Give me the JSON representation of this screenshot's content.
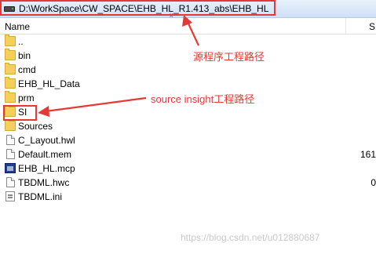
{
  "path_bar": {
    "path": "D:\\WorkSpace\\CW_SPACE\\EHB_HL_R1.413_abs\\EHB_HL",
    "glyph": "x"
  },
  "columns": {
    "name": "Name",
    "size": "S"
  },
  "items": [
    {
      "name": "..",
      "type": "folder",
      "size": ""
    },
    {
      "name": "bin",
      "type": "folder",
      "size": ""
    },
    {
      "name": "cmd",
      "type": "folder",
      "size": ""
    },
    {
      "name": "EHB_HL_Data",
      "type": "folder",
      "size": ""
    },
    {
      "name": "prm",
      "type": "folder",
      "size": ""
    },
    {
      "name": "SI",
      "type": "folder",
      "size": ""
    },
    {
      "name": "Sources",
      "type": "folder",
      "size": ""
    },
    {
      "name": "C_Layout.hwl",
      "type": "file",
      "size": ""
    },
    {
      "name": "Default.mem",
      "type": "file",
      "size": "161"
    },
    {
      "name": "EHB_HL.mcp",
      "type": "mcp",
      "size": ""
    },
    {
      "name": "TBDML.hwc",
      "type": "file",
      "size": "0"
    },
    {
      "name": "TBDML.ini",
      "type": "ini",
      "size": ""
    }
  ],
  "annotations": {
    "source_path": "源程序工程路径",
    "si_path": "source insight工程路径"
  },
  "watermark": "https://blog.csdn.net/u012880687",
  "colors": {
    "annotation": "#e53935",
    "folder": "#f4cf5b"
  }
}
